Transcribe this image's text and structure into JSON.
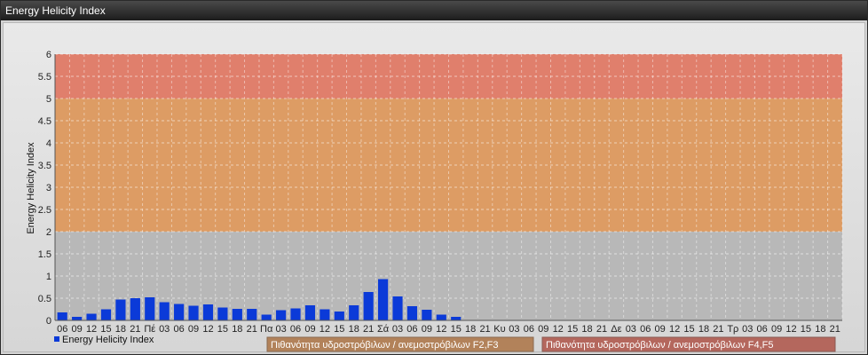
{
  "window": {
    "title": "Energy Helicity Index"
  },
  "colors": {
    "bar": "#0b3ad8",
    "band_low": "#b8b8b8",
    "band_mid": "#dd9c64",
    "band_high": "#e07f6c",
    "legend_mid": "#b2825a",
    "legend_high": "#b4675d"
  },
  "chart_data": {
    "type": "bar",
    "xlabel": "",
    "ylabel": "Energy Helicity Index",
    "ylim": [
      0,
      6
    ],
    "yticks": [
      "0",
      "0.5",
      "1",
      "1.5",
      "2",
      "2.5",
      "3",
      "3.5",
      "4",
      "4.5",
      "5",
      "5.5",
      "6"
    ],
    "grid": true,
    "bands": [
      {
        "from": 0,
        "to": 2,
        "color": "#b8b8b8"
      },
      {
        "from": 2,
        "to": 5,
        "color": "#dd9c64"
      },
      {
        "from": 5,
        "to": 6,
        "color": "#e07f6c"
      }
    ],
    "categories": [
      "06",
      "09",
      "12",
      "15",
      "18",
      "21",
      "Πέ",
      "03",
      "06",
      "09",
      "12",
      "15",
      "18",
      "21",
      "Πα",
      "03",
      "06",
      "09",
      "12",
      "15",
      "18",
      "21",
      "Σά",
      "03",
      "06",
      "09",
      "12",
      "15",
      "18",
      "21",
      "Κυ",
      "03",
      "06",
      "09",
      "12",
      "15",
      "18",
      "21",
      "Δε",
      "03",
      "06",
      "09",
      "12",
      "15",
      "18",
      "21",
      "Τρ",
      "03",
      "06",
      "09",
      "12",
      "15",
      "18",
      "21"
    ],
    "series": [
      {
        "name": "Energy Helicity Index",
        "values": [
          0.18,
          0.08,
          0.15,
          0.25,
          0.47,
          0.5,
          0.52,
          0.41,
          0.37,
          0.33,
          0.36,
          0.29,
          0.26,
          0.26,
          0.13,
          0.23,
          0.27,
          0.34,
          0.25,
          0.2,
          0.34,
          0.64,
          0.93,
          0.54,
          0.32,
          0.24,
          0.13,
          0.08,
          0.01,
          0.01,
          0.01,
          0.01,
          0.01,
          0.01,
          0.01,
          0.01,
          0.01,
          0.01,
          0.01,
          0.01,
          0.01,
          0.01,
          0.01,
          0.01,
          0.01,
          0.01,
          0.01,
          0.01,
          0.01,
          0.01,
          0.01,
          0.01,
          0.01,
          0.01
        ]
      }
    ],
    "legend": [
      {
        "label": "Energy Helicity Index"
      },
      {
        "label": "Πιθανότητα υδροστρόβιλων / ανεμοστρόβιλων F2,F3"
      },
      {
        "label": "Πιθανότητα υδροστρόβιλων / ανεμοστρόβιλων F4,F5"
      }
    ]
  }
}
